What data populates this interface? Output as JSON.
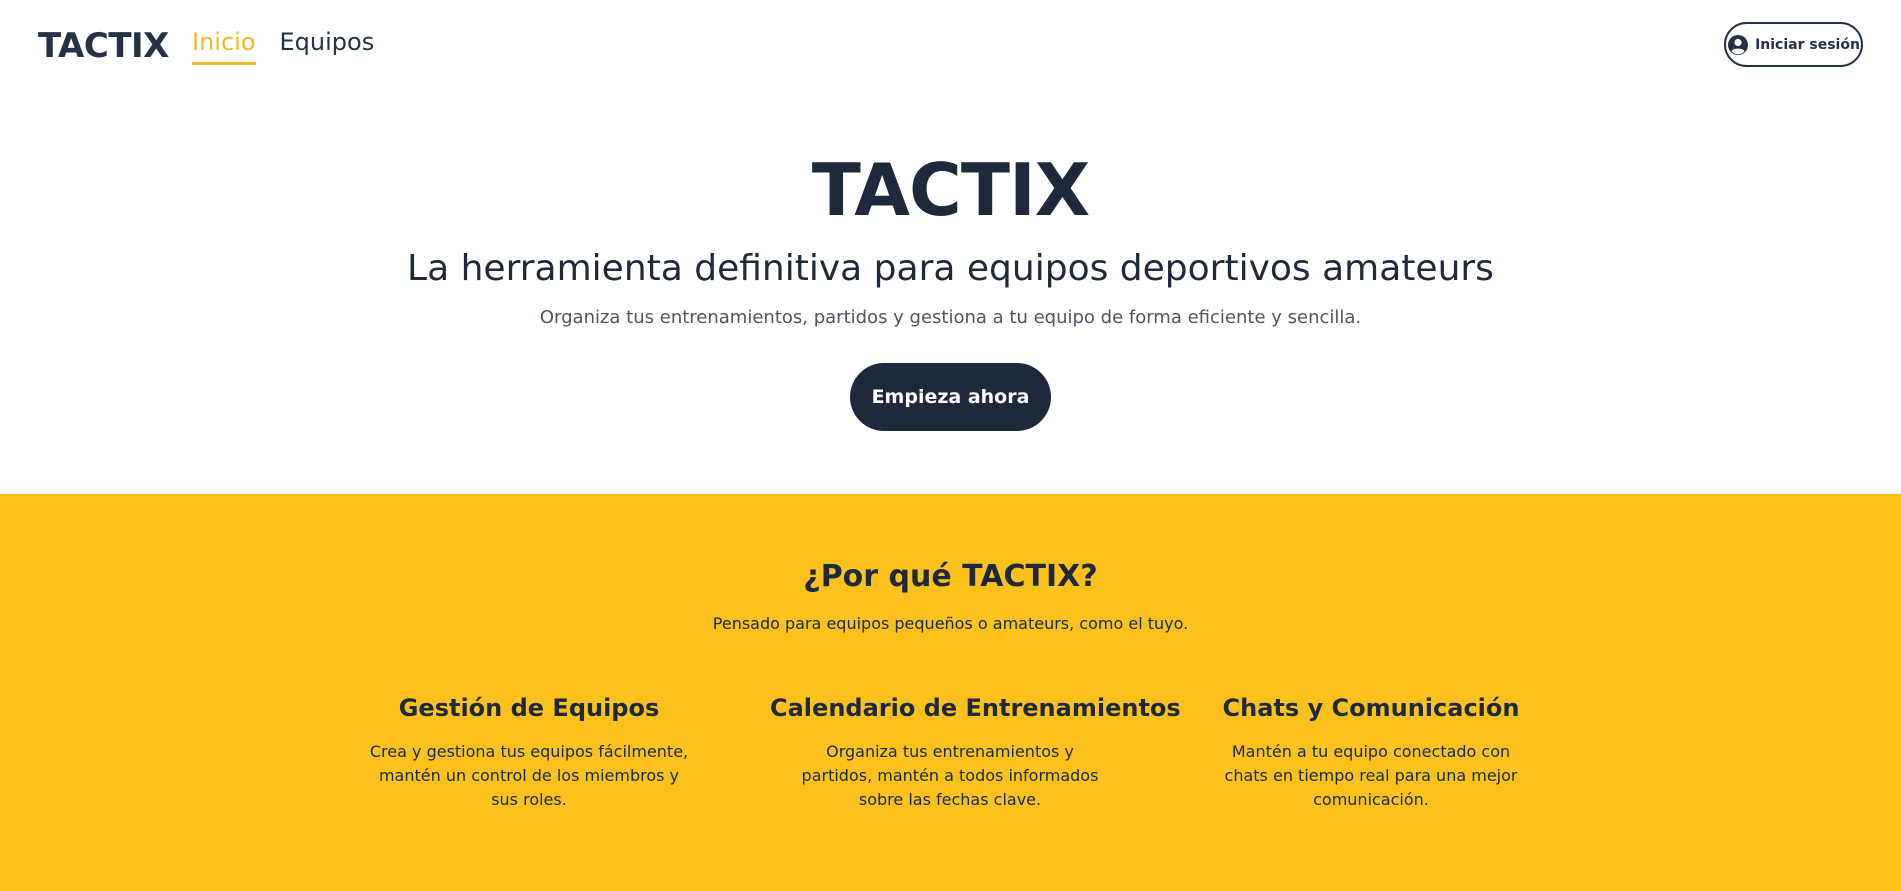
{
  "header": {
    "logo": "TACTIX",
    "nav": [
      {
        "label": "Inicio",
        "active": true
      },
      {
        "label": "Equipos",
        "active": false
      }
    ],
    "login_label": "Iniciar sesión",
    "login_icon": "user-circle-icon"
  },
  "hero": {
    "title": "TACTIX",
    "subtitle": "La herramienta definitiva para equipos deportivos amateurs",
    "description": "Organiza tus entrenamientos, partidos y gestiona a tu equipo de forma eficiente y sencilla.",
    "cta_label": "Empieza ahora"
  },
  "features": {
    "title": "¿Por qué TACTIX?",
    "subtitle": "Pensado para equipos pequeños o amateurs, como el tuyo.",
    "items": [
      {
        "title": "Gestión de Equipos",
        "text": "Crea y gestiona tus equipos fácilmente, mantén un control de los miembros y sus roles."
      },
      {
        "title": "Calendario de Entrenamientos",
        "text": "Organiza tus entrenamientos y partidos, mantén a todos informados sobre las fechas clave."
      },
      {
        "title": "Chats y Comunicación",
        "text": "Mantén a tu equipo conectado con chats en tiempo real para una mejor comunicación."
      }
    ]
  },
  "colors": {
    "accent": "#f2b72a",
    "features_bg": "#fbc21e",
    "primary_dark": "#1e293b"
  }
}
